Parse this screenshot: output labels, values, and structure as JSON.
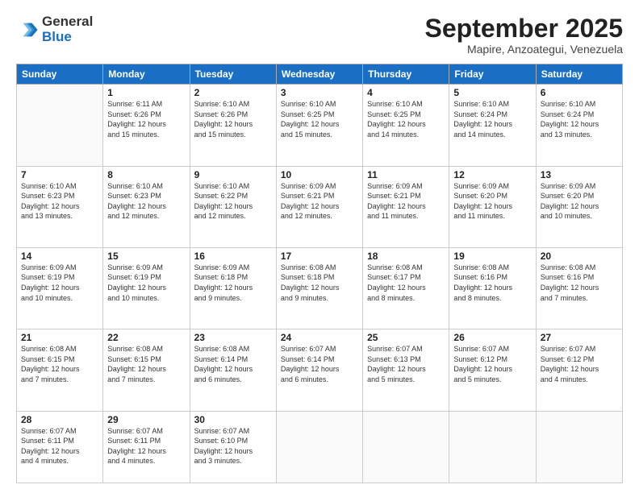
{
  "header": {
    "logo_general": "General",
    "logo_blue": "Blue",
    "month_title": "September 2025",
    "subtitle": "Mapire, Anzoategui, Venezuela"
  },
  "weekdays": [
    "Sunday",
    "Monday",
    "Tuesday",
    "Wednesday",
    "Thursday",
    "Friday",
    "Saturday"
  ],
  "weeks": [
    [
      {
        "num": "",
        "info": ""
      },
      {
        "num": "1",
        "info": "Sunrise: 6:11 AM\nSunset: 6:26 PM\nDaylight: 12 hours\nand 15 minutes."
      },
      {
        "num": "2",
        "info": "Sunrise: 6:10 AM\nSunset: 6:26 PM\nDaylight: 12 hours\nand 15 minutes."
      },
      {
        "num": "3",
        "info": "Sunrise: 6:10 AM\nSunset: 6:25 PM\nDaylight: 12 hours\nand 15 minutes."
      },
      {
        "num": "4",
        "info": "Sunrise: 6:10 AM\nSunset: 6:25 PM\nDaylight: 12 hours\nand 14 minutes."
      },
      {
        "num": "5",
        "info": "Sunrise: 6:10 AM\nSunset: 6:24 PM\nDaylight: 12 hours\nand 14 minutes."
      },
      {
        "num": "6",
        "info": "Sunrise: 6:10 AM\nSunset: 6:24 PM\nDaylight: 12 hours\nand 13 minutes."
      }
    ],
    [
      {
        "num": "7",
        "info": "Sunrise: 6:10 AM\nSunset: 6:23 PM\nDaylight: 12 hours\nand 13 minutes."
      },
      {
        "num": "8",
        "info": "Sunrise: 6:10 AM\nSunset: 6:23 PM\nDaylight: 12 hours\nand 12 minutes."
      },
      {
        "num": "9",
        "info": "Sunrise: 6:10 AM\nSunset: 6:22 PM\nDaylight: 12 hours\nand 12 minutes."
      },
      {
        "num": "10",
        "info": "Sunrise: 6:09 AM\nSunset: 6:21 PM\nDaylight: 12 hours\nand 12 minutes."
      },
      {
        "num": "11",
        "info": "Sunrise: 6:09 AM\nSunset: 6:21 PM\nDaylight: 12 hours\nand 11 minutes."
      },
      {
        "num": "12",
        "info": "Sunrise: 6:09 AM\nSunset: 6:20 PM\nDaylight: 12 hours\nand 11 minutes."
      },
      {
        "num": "13",
        "info": "Sunrise: 6:09 AM\nSunset: 6:20 PM\nDaylight: 12 hours\nand 10 minutes."
      }
    ],
    [
      {
        "num": "14",
        "info": "Sunrise: 6:09 AM\nSunset: 6:19 PM\nDaylight: 12 hours\nand 10 minutes."
      },
      {
        "num": "15",
        "info": "Sunrise: 6:09 AM\nSunset: 6:19 PM\nDaylight: 12 hours\nand 10 minutes."
      },
      {
        "num": "16",
        "info": "Sunrise: 6:09 AM\nSunset: 6:18 PM\nDaylight: 12 hours\nand 9 minutes."
      },
      {
        "num": "17",
        "info": "Sunrise: 6:08 AM\nSunset: 6:18 PM\nDaylight: 12 hours\nand 9 minutes."
      },
      {
        "num": "18",
        "info": "Sunrise: 6:08 AM\nSunset: 6:17 PM\nDaylight: 12 hours\nand 8 minutes."
      },
      {
        "num": "19",
        "info": "Sunrise: 6:08 AM\nSunset: 6:16 PM\nDaylight: 12 hours\nand 8 minutes."
      },
      {
        "num": "20",
        "info": "Sunrise: 6:08 AM\nSunset: 6:16 PM\nDaylight: 12 hours\nand 7 minutes."
      }
    ],
    [
      {
        "num": "21",
        "info": "Sunrise: 6:08 AM\nSunset: 6:15 PM\nDaylight: 12 hours\nand 7 minutes."
      },
      {
        "num": "22",
        "info": "Sunrise: 6:08 AM\nSunset: 6:15 PM\nDaylight: 12 hours\nand 7 minutes."
      },
      {
        "num": "23",
        "info": "Sunrise: 6:08 AM\nSunset: 6:14 PM\nDaylight: 12 hours\nand 6 minutes."
      },
      {
        "num": "24",
        "info": "Sunrise: 6:07 AM\nSunset: 6:14 PM\nDaylight: 12 hours\nand 6 minutes."
      },
      {
        "num": "25",
        "info": "Sunrise: 6:07 AM\nSunset: 6:13 PM\nDaylight: 12 hours\nand 5 minutes."
      },
      {
        "num": "26",
        "info": "Sunrise: 6:07 AM\nSunset: 6:12 PM\nDaylight: 12 hours\nand 5 minutes."
      },
      {
        "num": "27",
        "info": "Sunrise: 6:07 AM\nSunset: 6:12 PM\nDaylight: 12 hours\nand 4 minutes."
      }
    ],
    [
      {
        "num": "28",
        "info": "Sunrise: 6:07 AM\nSunset: 6:11 PM\nDaylight: 12 hours\nand 4 minutes."
      },
      {
        "num": "29",
        "info": "Sunrise: 6:07 AM\nSunset: 6:11 PM\nDaylight: 12 hours\nand 4 minutes."
      },
      {
        "num": "30",
        "info": "Sunrise: 6:07 AM\nSunset: 6:10 PM\nDaylight: 12 hours\nand 3 minutes."
      },
      {
        "num": "",
        "info": ""
      },
      {
        "num": "",
        "info": ""
      },
      {
        "num": "",
        "info": ""
      },
      {
        "num": "",
        "info": ""
      }
    ]
  ]
}
